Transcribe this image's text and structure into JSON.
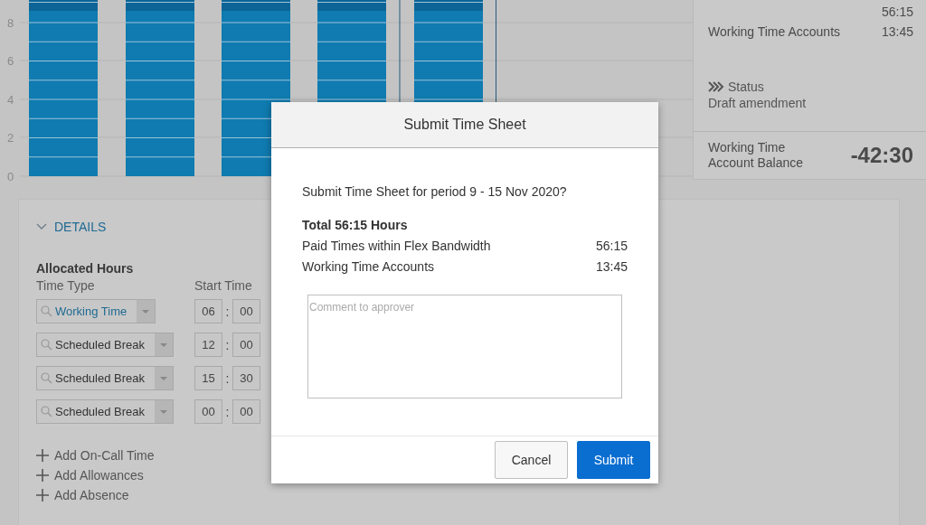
{
  "chart": {
    "y_axis_labels": [
      "8",
      "6",
      "4",
      "2",
      "0"
    ]
  },
  "summary": {
    "top_value": "56:15",
    "rows": [
      {
        "label": "Working Time Accounts",
        "value": "13:45"
      }
    ],
    "status": {
      "label": "Status",
      "value": "Draft amendment"
    },
    "balance": {
      "label": "Working Time Account Balance",
      "value": "-42:30"
    }
  },
  "details": {
    "header": "DETAILS",
    "expanded": true,
    "section_title": "Allocated Hours",
    "columns": [
      "Time Type",
      "Start Time"
    ],
    "rows": [
      {
        "time_type": "Working Time",
        "highlighted": true,
        "hours": "06",
        "separator": ":",
        "minutes": "00"
      },
      {
        "time_type": "Scheduled Break",
        "highlighted": false,
        "hours": "12",
        "separator": ":",
        "minutes": "00"
      },
      {
        "time_type": "Scheduled Break",
        "highlighted": false,
        "hours": "15",
        "separator": ":",
        "minutes": "30"
      },
      {
        "time_type": "Scheduled Break",
        "highlighted": false,
        "hours": "00",
        "separator": ":",
        "minutes": "00"
      }
    ],
    "actions": [
      "Add On-Call Time",
      "Add Allowances",
      "Add Absence"
    ]
  },
  "dialog": {
    "title": "Submit Time Sheet",
    "question": "Submit Time Sheet for period 9 - 15 Nov 2020?",
    "total": "Total 56:15 Hours",
    "lines": [
      {
        "label": "Paid Times within Flex Bandwidth",
        "value": "56:15"
      },
      {
        "label": "Working Time Accounts",
        "value": "13:45"
      }
    ],
    "comment_placeholder": "Comment to approver",
    "buttons": [
      {
        "label": "Cancel",
        "kind": "default"
      },
      {
        "label": "Submit",
        "kind": "emphasized"
      }
    ]
  }
}
